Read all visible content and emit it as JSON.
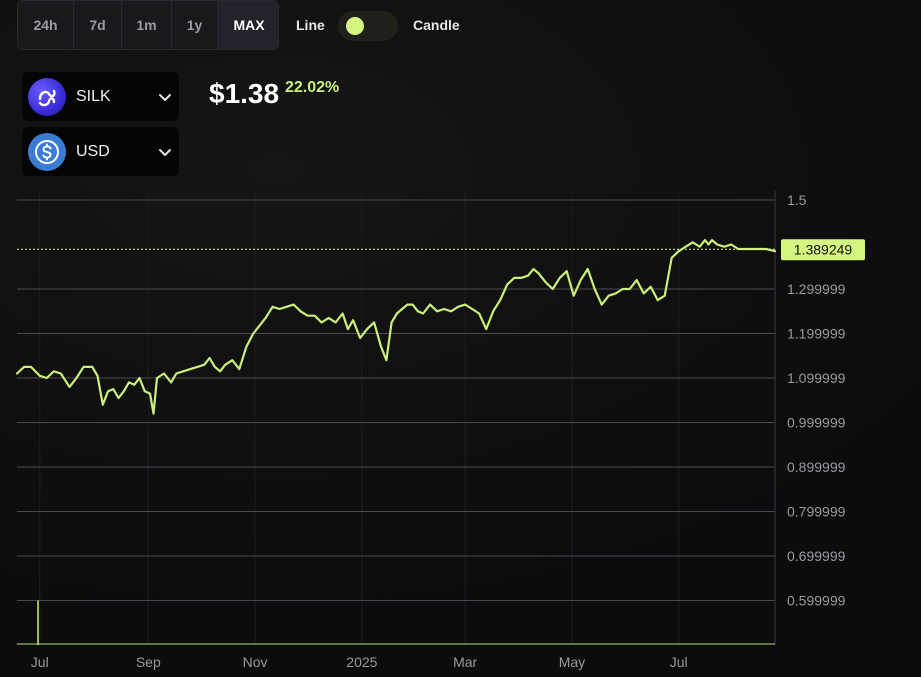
{
  "timeframes": [
    {
      "label": "24h",
      "active": false
    },
    {
      "label": "7d",
      "active": false
    },
    {
      "label": "1m",
      "active": false
    },
    {
      "label": "1y",
      "active": false
    },
    {
      "label": "MAX",
      "active": true
    }
  ],
  "chart_mode": {
    "line_label": "Line",
    "candle_label": "Candle",
    "selected": "Line"
  },
  "base_token": {
    "symbol": "SILK",
    "icon": "silk-logo-icon"
  },
  "quote_token": {
    "symbol": "USD",
    "icon": "usdc-logo-icon"
  },
  "price": {
    "value": "$1.38",
    "change": "22.02%"
  },
  "colors": {
    "accent": "#c9f07a",
    "grid": "#4a4a55",
    "axis_text": "#9a9aa0",
    "background": "#0b0b0c"
  },
  "chart_data": {
    "type": "line",
    "title": "",
    "xlabel": "",
    "ylabel": "",
    "x_ticks": [
      "Jul",
      "Sep",
      "Nov",
      "2025",
      "Mar",
      "May",
      "Jul"
    ],
    "x_tick_dates": [
      "2024-07-01",
      "2024-09-01",
      "2024-11-01",
      "2025-01-01",
      "2025-03-01",
      "2025-05-01",
      "2025-07-01"
    ],
    "x_range": [
      "2024-06-18",
      "2025-08-25"
    ],
    "y_ticks": [
      "1.5",
      "1.299999",
      "1.199999",
      "1.099999",
      "0.999999",
      "0.899999",
      "0.799999",
      "0.699999",
      "0.599999"
    ],
    "ylim": [
      0.5,
      1.5
    ],
    "grid": true,
    "current_value": "1.389249",
    "series": [
      {
        "dates": [
          "2024-06-18",
          "2024-06-22",
          "2024-06-26",
          "2024-07-01",
          "2024-07-05",
          "2024-07-09",
          "2024-07-13",
          "2024-07-18",
          "2024-07-22",
          "2024-07-26",
          "2024-07-31",
          "2024-08-03",
          "2024-08-06",
          "2024-08-09",
          "2024-08-12",
          "2024-08-15",
          "2024-08-18",
          "2024-08-21",
          "2024-08-24",
          "2024-08-27",
          "2024-08-30",
          "2024-09-02",
          "2024-09-04",
          "2024-09-06",
          "2024-09-10",
          "2024-09-14",
          "2024-09-17",
          "2024-09-21",
          "2024-09-25",
          "2024-09-29",
          "2024-10-03",
          "2024-10-06",
          "2024-10-09",
          "2024-10-12",
          "2024-10-15",
          "2024-10-19",
          "2024-10-23",
          "2024-10-27",
          "2024-10-31",
          "2024-11-03",
          "2024-11-07",
          "2024-11-11",
          "2024-11-15",
          "2024-11-19",
          "2024-11-23",
          "2024-11-27",
          "2024-12-01",
          "2024-12-05",
          "2024-12-09",
          "2024-12-13",
          "2024-12-17",
          "2024-12-21",
          "2024-12-24",
          "2024-12-27",
          "2024-12-31",
          "2025-01-04",
          "2025-01-08",
          "2025-01-12",
          "2025-01-15",
          "2025-01-18",
          "2025-01-21",
          "2025-01-24",
          "2025-01-27",
          "2025-01-30",
          "2025-02-02",
          "2025-02-05",
          "2025-02-09",
          "2025-02-13",
          "2025-02-17",
          "2025-02-21",
          "2025-02-25",
          "2025-03-01",
          "2025-03-05",
          "2025-03-09",
          "2025-03-13",
          "2025-03-17",
          "2025-03-21",
          "2025-03-25",
          "2025-03-29",
          "2025-04-02",
          "2025-04-06",
          "2025-04-09",
          "2025-04-12",
          "2025-04-16",
          "2025-04-20",
          "2025-04-24",
          "2025-04-28",
          "2025-05-02",
          "2025-05-06",
          "2025-05-10",
          "2025-05-14",
          "2025-05-18",
          "2025-05-22",
          "2025-05-26",
          "2025-05-30",
          "2025-06-03",
          "2025-06-07",
          "2025-06-11",
          "2025-06-15",
          "2025-06-19",
          "2025-06-23",
          "2025-06-27",
          "2025-07-01",
          "2025-07-05",
          "2025-07-09",
          "2025-07-13",
          "2025-07-16",
          "2025-07-18",
          "2025-07-20",
          "2025-07-23",
          "2025-07-27",
          "2025-07-31",
          "2025-08-04",
          "2025-08-08",
          "2025-08-12",
          "2025-08-16",
          "2025-08-20",
          "2025-08-25"
        ],
        "values": [
          1.11,
          1.125,
          1.125,
          1.105,
          1.1,
          1.115,
          1.11,
          1.08,
          1.1,
          1.125,
          1.125,
          1.105,
          1.04,
          1.07,
          1.075,
          1.055,
          1.07,
          1.09,
          1.085,
          1.1,
          1.07,
          1.065,
          1.02,
          1.1,
          1.11,
          1.09,
          1.11,
          1.115,
          1.12,
          1.125,
          1.13,
          1.145,
          1.125,
          1.115,
          1.13,
          1.14,
          1.12,
          1.17,
          1.2,
          1.215,
          1.235,
          1.26,
          1.255,
          1.26,
          1.265,
          1.25,
          1.24,
          1.24,
          1.225,
          1.235,
          1.225,
          1.245,
          1.21,
          1.23,
          1.19,
          1.21,
          1.225,
          1.17,
          1.14,
          1.225,
          1.245,
          1.255,
          1.265,
          1.265,
          1.25,
          1.245,
          1.265,
          1.25,
          1.255,
          1.25,
          1.26,
          1.265,
          1.255,
          1.245,
          1.21,
          1.25,
          1.275,
          1.31,
          1.325,
          1.325,
          1.33,
          1.345,
          1.335,
          1.315,
          1.3,
          1.325,
          1.34,
          1.285,
          1.32,
          1.345,
          1.3,
          1.265,
          1.285,
          1.29,
          1.3,
          1.3,
          1.32,
          1.29,
          1.305,
          1.275,
          1.285,
          1.37,
          1.385,
          1.395,
          1.405,
          1.395,
          1.41,
          1.4,
          1.41,
          1.4,
          1.395,
          1.4,
          1.39,
          1.39,
          1.39,
          1.39,
          1.39,
          1.385
        ]
      }
    ],
    "volume_spike": {
      "date": "2024-06-30",
      "value": 0.6
    }
  }
}
